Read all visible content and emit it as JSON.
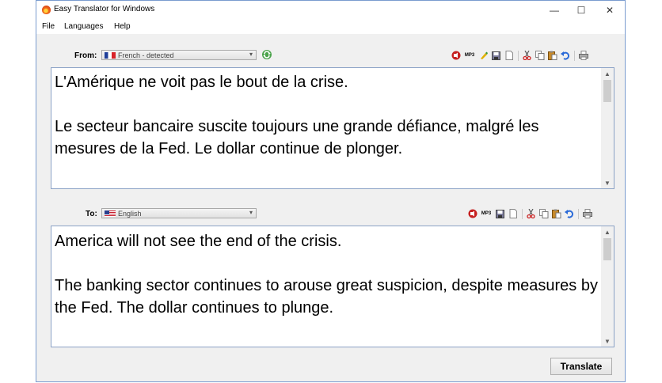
{
  "window": {
    "title": "Easy Translator for Windows",
    "minimize": "—",
    "maximize": "☐",
    "close": "✕"
  },
  "menu": [
    "File",
    "Languages",
    "Help"
  ],
  "from": {
    "label": "From:",
    "language": "French - detected"
  },
  "to": {
    "label": "To:",
    "language": "English"
  },
  "source_text": "L'Amérique ne voit pas le bout de la crise.\n\nLe secteur bancaire suscite toujours une grande défiance, malgré les mesures de la Fed. Le dollar continue de plonger.",
  "target_text": "America will not see the end of the crisis.\n\nThe banking sector continues to arouse great suspicion, despite measures by the Fed. The dollar continues to plunge.",
  "buttons": {
    "translate": "Translate",
    "mp3": "MP3"
  },
  "icons": [
    "speaker-icon",
    "mp3-icon",
    "clear-icon",
    "save-icon",
    "new-document-icon",
    "cut-icon",
    "copy-icon",
    "paste-icon",
    "undo-icon",
    "print-icon",
    "swap-languages-icon"
  ]
}
